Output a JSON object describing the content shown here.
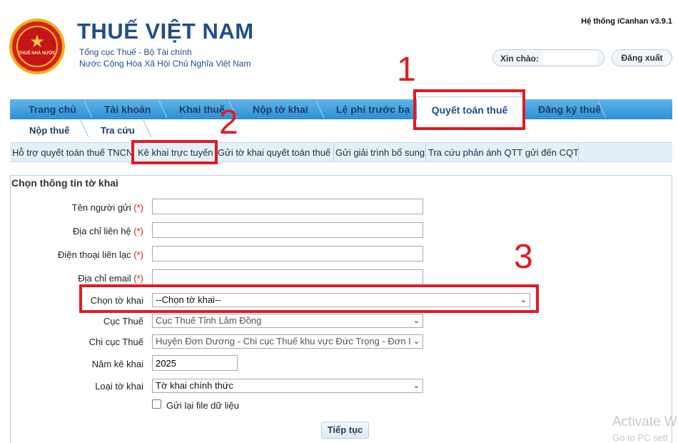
{
  "header": {
    "logo_text": "THUẾ NHÀ NƯỚC",
    "title": "THUẾ VIỆT NAM",
    "subtitle_1": "Tổng cục Thuế - Bộ Tài chính",
    "subtitle_2": "Nước Cộng Hòa Xã Hội Chủ Nghĩa Việt Nam",
    "system_version": "Hệ thống iCanhan v3.9.1",
    "greeting_label": "Xin chào:",
    "greeting_value": "",
    "logout_label": "Đăng xuất"
  },
  "main_nav": {
    "items": [
      "Trang chủ",
      "Tài khoản",
      "Khai thuế",
      "Nộp tờ khai",
      "Lệ phí trước bạ",
      "Quyết toán thuế",
      "Đăng ký thuế"
    ],
    "active": "Quyết toán thuế"
  },
  "sub_nav": {
    "items": [
      "Nộp thuế",
      "Tra cứu"
    ]
  },
  "function_bar": {
    "items": [
      "Hỗ trợ quyết toán thuế TNCN",
      "Kê khai trực tuyến",
      "Gửi tờ khai quyết toán thuế",
      "Gửi giải trình bổ sung",
      "Tra cứu phản ánh QTT gửi đến CQT"
    ],
    "active": "Kê khai trực tuyến"
  },
  "form": {
    "title": "Chọn thông tin tờ khai",
    "required_mark": "(*)",
    "sender_name_label": "Tên người gửi",
    "sender_name_value": "",
    "address_label": "Địa chỉ liên hệ",
    "address_value": "",
    "phone_label": "Điện thoại liên lạc",
    "phone_value": "",
    "email_label": "Địa chỉ email",
    "email_value": "",
    "form_select_label": "Chọn tờ khai",
    "form_select_value": "--Chọn tờ khai--",
    "tax_dept_label": "Cục Thuế",
    "tax_dept_value": "Cục Thuế Tỉnh Lâm Đồng",
    "sub_dept_label": "Chi cục Thuế",
    "sub_dept_value": "Huyện Đơn Dương - Chi cục Thuế khu vực Đức Trọng - Đơn I",
    "year_label": "Năm kê khai",
    "year_value": "2025",
    "type_label": "Loại tờ khai",
    "type_value": "Tờ khai chính thức",
    "resend_label": "Gửi lại file dữ liệu",
    "resend_checked": false,
    "continue_label": "Tiếp tục"
  },
  "annotations": {
    "step_1": "1",
    "step_2": "2",
    "step_3": "3",
    "color": "#e01b24"
  },
  "watermark": {
    "line_1": "Activate W",
    "line_2": "Go to PC sett"
  },
  "colors": {
    "brand_blue": "#1f4e8a",
    "nav_blue": "#2e8fd4",
    "required_red": "#d32020"
  }
}
